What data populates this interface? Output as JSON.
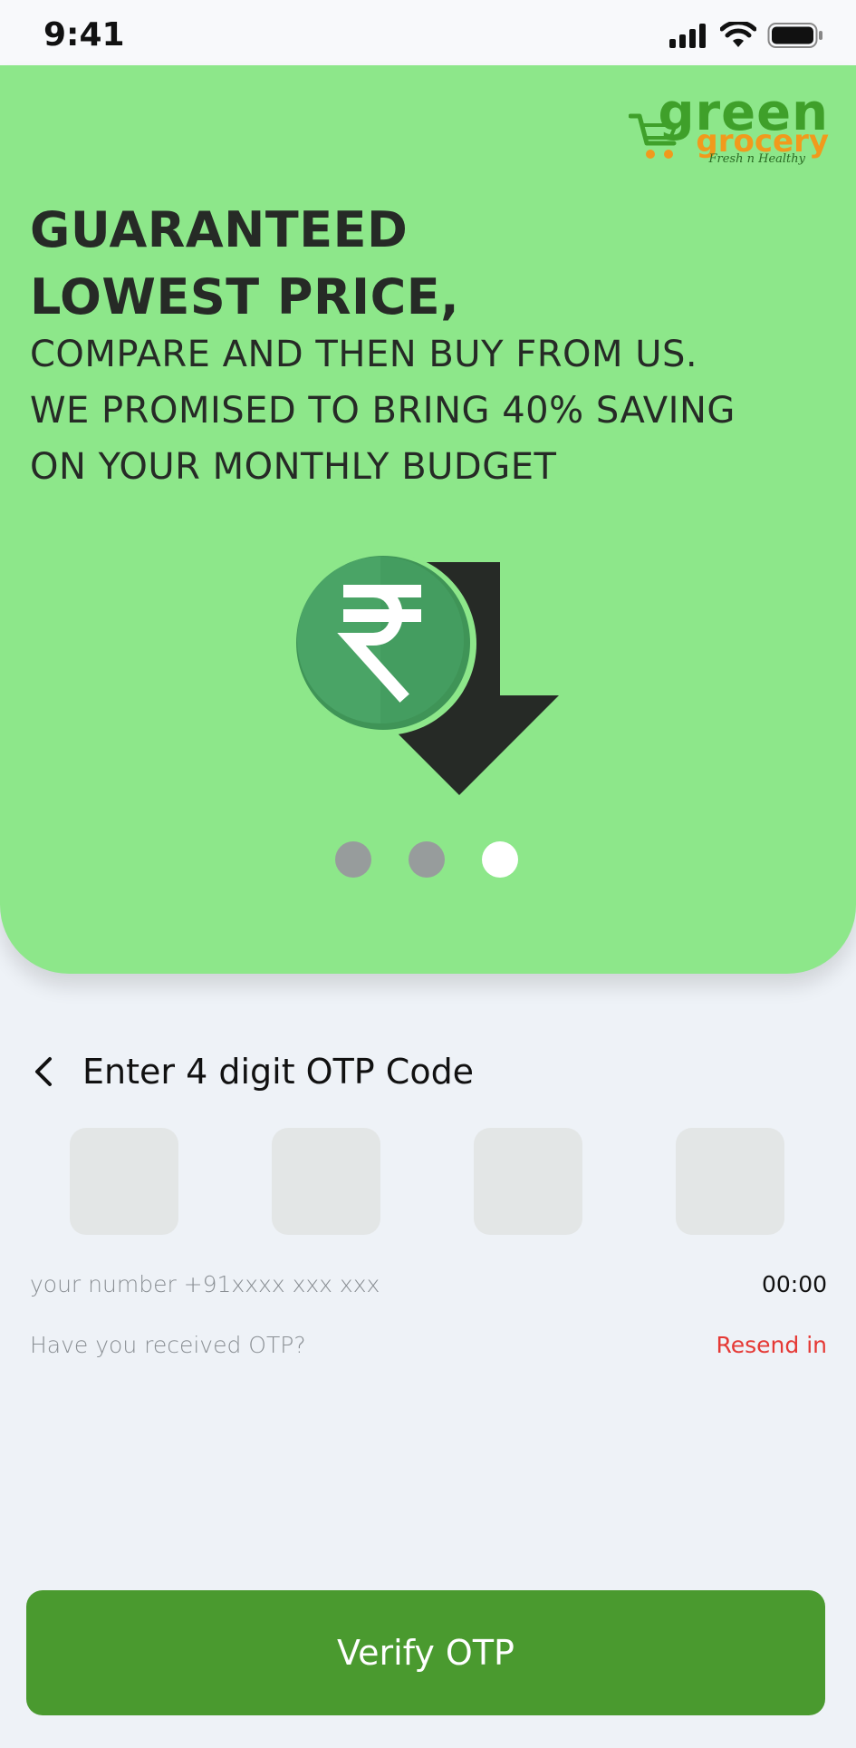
{
  "status_bar": {
    "time": "9:41",
    "icons": [
      "signal-icon",
      "wifi-icon",
      "battery-icon"
    ]
  },
  "brand": {
    "line1": "green",
    "line2": "grocery",
    "tagline": "Fresh n Healthy"
  },
  "hero": {
    "headline": [
      "GUARANTEED",
      "LOWEST PRICE,"
    ],
    "body": [
      "COMPARE AND THEN BUY FROM US.",
      "WE PROMISED TO BRING 40% SAVING",
      "ON YOUR MONTHLY BUDGET"
    ],
    "illustration": "rupee-price-drop-icon",
    "carousel": {
      "count": 3,
      "active_index": 2
    }
  },
  "otp": {
    "title": "Enter 4 digit OTP Code",
    "digits": [
      "",
      "",
      "",
      ""
    ],
    "number_text": "your number +91xxxx xxx xxx",
    "timer": "00:00",
    "received_prompt": "Have you received OTP?",
    "resend_label": "Resend in"
  },
  "verify_button": "Verify OTP",
  "colors": {
    "hero_bg": "#8de78a",
    "primary_button": "#4a9a2f",
    "resend": "#e53935",
    "page_bg": "#eef2f7"
  }
}
